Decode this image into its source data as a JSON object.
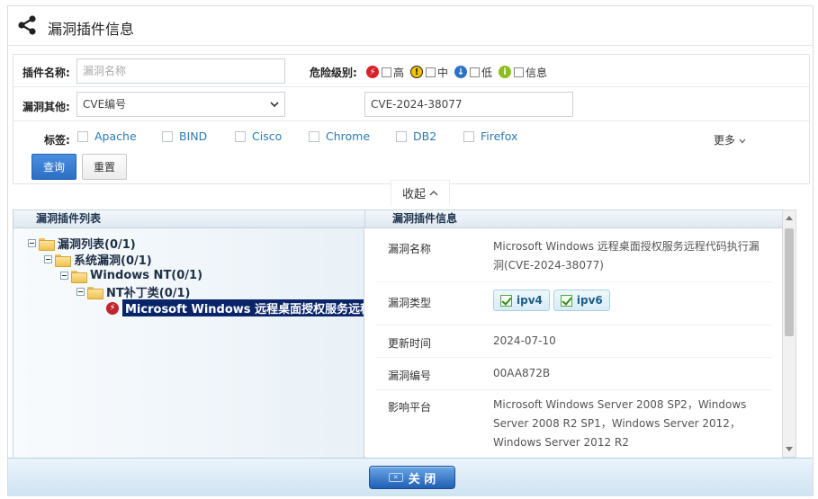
{
  "header": {
    "title": "漏洞插件信息",
    "icon": "share-icon"
  },
  "filters": {
    "name_label": "插件名称:",
    "name_placeholder": "漏洞名称",
    "risk_label": "危险级别:",
    "risk_levels": [
      {
        "label": "高",
        "color": "#d6232a",
        "glyph": "⚡"
      },
      {
        "label": "中",
        "color": "#f2c200",
        "glyph": "!"
      },
      {
        "label": "低",
        "color": "#2b72c7",
        "glyph": "↓"
      },
      {
        "label": "信息",
        "color": "#8bbf1e",
        "glyph": "i"
      }
    ],
    "other_label": "漏洞其他:",
    "other_select": "CVE编号",
    "other_value": "CVE-2024-38077",
    "tags_label": "标签:",
    "tags": [
      "Apache",
      "BIND",
      "Cisco",
      "Chrome",
      "DB2",
      "Firefox"
    ],
    "more_label": "更多",
    "query_button": "查询",
    "reset_button": "重置"
  },
  "collapse_label": "收起",
  "tree": {
    "header": "漏洞插件列表",
    "nodes": [
      {
        "label": "漏洞列表(0/1)"
      },
      {
        "label": "系统漏洞(0/1)"
      },
      {
        "label": "Windows NT(0/1)"
      },
      {
        "label": "NT补丁类(0/1)"
      },
      {
        "label": "Microsoft Windows 远程桌面授权服务远程代码执行漏洞"
      }
    ]
  },
  "info": {
    "header": "漏洞插件信息",
    "name_label": "漏洞名称",
    "name_value": "Microsoft Windows 远程桌面授权服务远程代码执行漏洞(CVE-2024-38077)",
    "type_label": "漏洞类型",
    "types": [
      "ipv4",
      "ipv6"
    ],
    "update_label": "更新时间",
    "update_value": "2024-07-10",
    "id_label": "漏洞编号",
    "id_value": "00AA872B",
    "platform_label": "影响平台",
    "platform_value": "Microsoft Windows Server 2008 SP2，Windows Server 2008 R2 SP1，Windows Server 2012，Windows Server 2012 R2"
  },
  "footer": {
    "close_button": "关 闭"
  }
}
